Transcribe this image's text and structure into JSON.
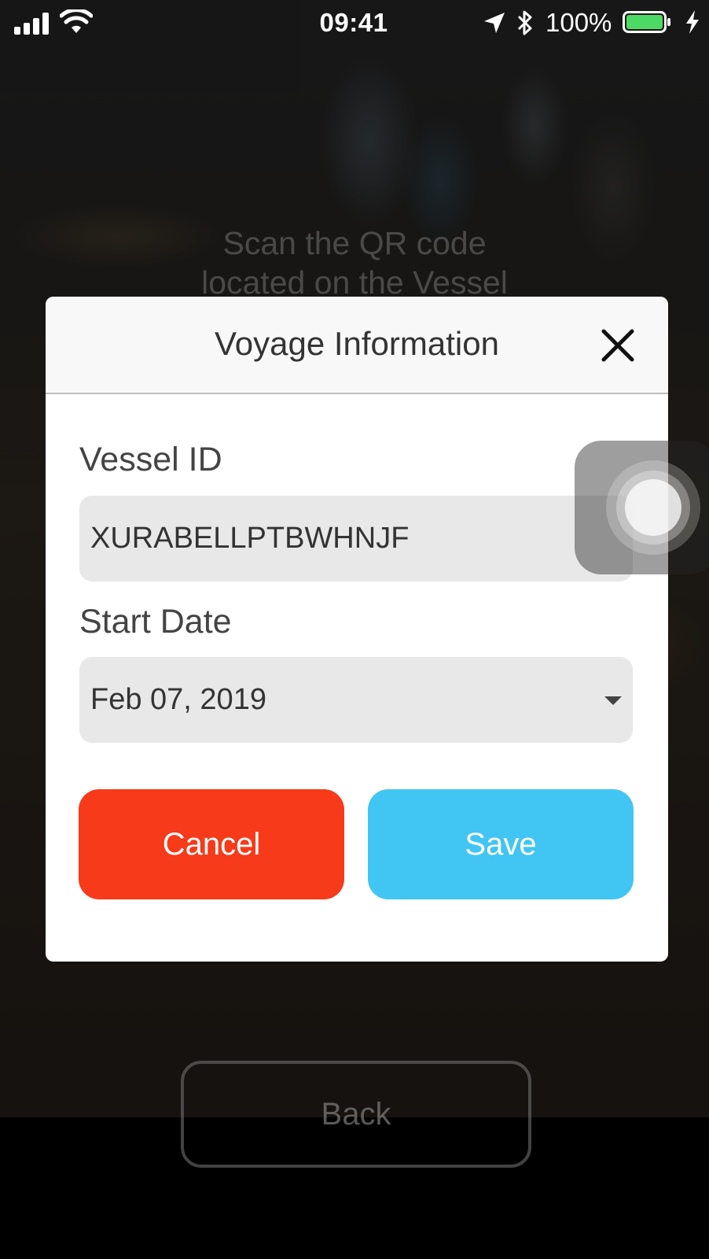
{
  "status_bar": {
    "time": "09:41",
    "battery_percent": "100%",
    "icons": [
      "signal-icon",
      "wifi-icon",
      "location-arrow-icon",
      "bluetooth-icon",
      "battery-icon",
      "charging-bolt-icon"
    ]
  },
  "background": {
    "scan_instruction_line1": "Scan the QR code",
    "scan_instruction_line2": "located on the Vessel",
    "back_label": "Back"
  },
  "modal": {
    "title": "Voyage Information",
    "close_icon": "close-icon",
    "vessel_id_label": "Vessel ID",
    "vessel_id_value": "XURABELLPTBWHNJF",
    "start_date_label": "Start Date",
    "start_date_value": "Feb 07, 2019",
    "cancel_label": "Cancel",
    "save_label": "Save"
  },
  "colors": {
    "cancel": "#f63a1a",
    "save": "#41c5f2",
    "battery_fill": "#4cd964",
    "field_bg": "#e8e8e8"
  }
}
